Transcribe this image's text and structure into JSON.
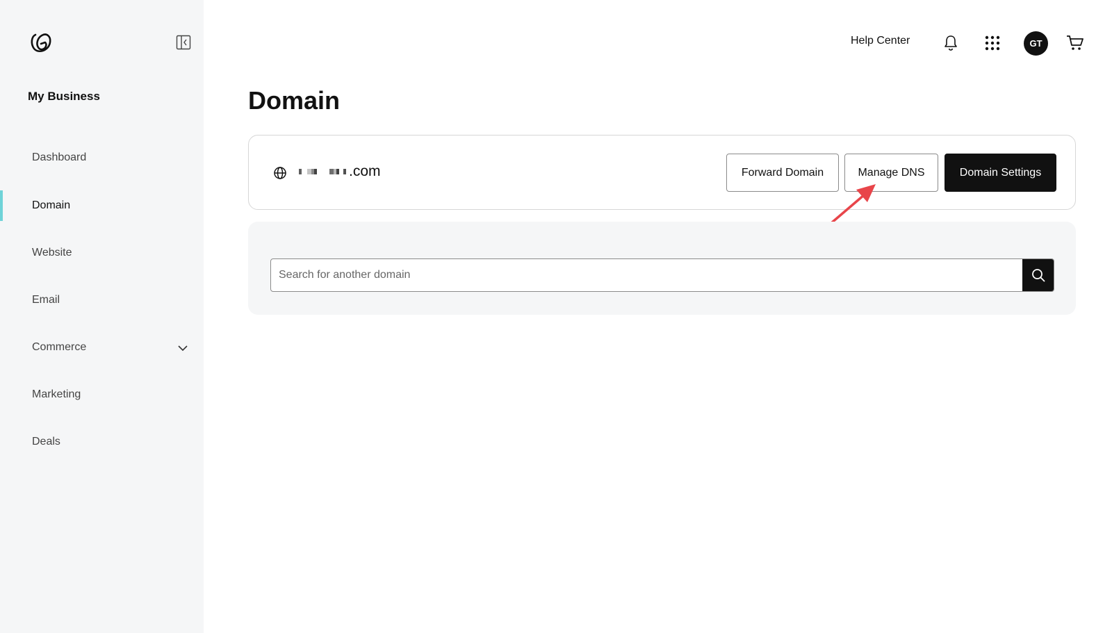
{
  "sidebar": {
    "brand": "My Business",
    "items": [
      {
        "label": "Dashboard",
        "active": false
      },
      {
        "label": "Domain",
        "active": true
      },
      {
        "label": "Website",
        "active": false
      },
      {
        "label": "Email",
        "active": false
      },
      {
        "label": "Commerce",
        "active": false,
        "expandable": true
      },
      {
        "label": "Marketing",
        "active": false
      },
      {
        "label": "Deals",
        "active": false
      }
    ]
  },
  "header": {
    "help_label": "Help Center",
    "icons": [
      "bell-icon",
      "apps-grid-icon",
      "cart-icon"
    ],
    "avatar_initials": "GT"
  },
  "main": {
    "title": "Domain",
    "domain_card": {
      "domain_suffix": ".com",
      "buttons": {
        "forward": "Forward Domain",
        "manage_dns": "Manage DNS",
        "settings": "Domain Settings"
      }
    },
    "search": {
      "placeholder": "Search for another domain"
    }
  },
  "colors": {
    "accent": "#6fd3d8",
    "annotation_arrow": "#e8454a",
    "primary_button": "#111111",
    "sidebar_bg": "#f5f6f7"
  }
}
